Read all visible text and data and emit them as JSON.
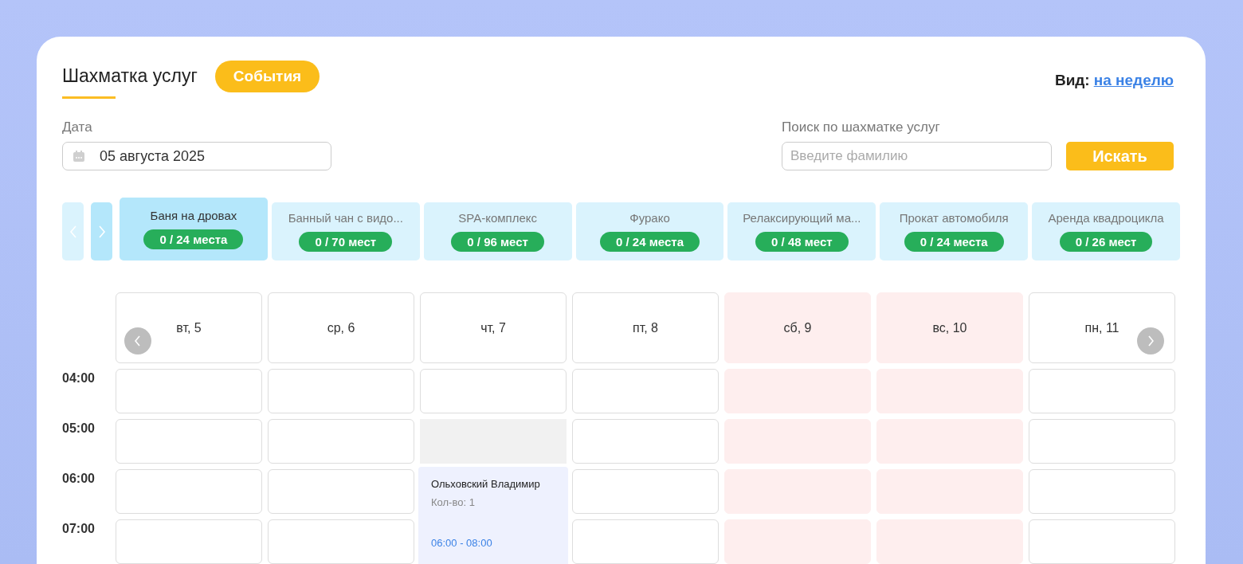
{
  "header": {
    "title": "Шахматка услуг",
    "events_button": "События",
    "view_label": "Вид:",
    "view_link": "на неделю"
  },
  "date": {
    "label": "Дата",
    "value": "05 августа 2025"
  },
  "search": {
    "label": "Поиск по шахматке услуг",
    "placeholder": "Введите фамилию",
    "button": "Искать"
  },
  "services_nav": {
    "prev_disabled": true,
    "next_disabled": false
  },
  "services": [
    {
      "name": "Баня на дровах",
      "places": "0 / 24 места",
      "selected": true
    },
    {
      "name": "Банный чан с видо...",
      "places": "0 / 70 мест",
      "selected": false
    },
    {
      "name": "SPA-комплекс",
      "places": "0 / 96 мест",
      "selected": false
    },
    {
      "name": "Фурако",
      "places": "0 / 24 места",
      "selected": false
    },
    {
      "name": "Релаксирующий ма...",
      "places": "0 / 48 мест",
      "selected": false
    },
    {
      "name": "Прокат автомобиля",
      "places": "0 / 24 места",
      "selected": false
    },
    {
      "name": "Аренда квадроцикла",
      "places": "0 / 26 мест",
      "selected": false
    }
  ],
  "days": [
    {
      "label": "вт, 5",
      "weekend": false
    },
    {
      "label": "ср, 6",
      "weekend": false
    },
    {
      "label": "чт, 7",
      "weekend": false
    },
    {
      "label": "пт, 8",
      "weekend": false
    },
    {
      "label": "сб, 9",
      "weekend": true
    },
    {
      "label": "вс, 10",
      "weekend": true
    },
    {
      "label": "пн, 11",
      "weekend": false
    }
  ],
  "rows": [
    {
      "time": "04:00",
      "cells": [
        {
          "kind": "free"
        },
        {
          "kind": "free"
        },
        {
          "kind": "free"
        },
        {
          "kind": "free"
        },
        {
          "kind": "free"
        },
        {
          "kind": "free"
        },
        {
          "kind": "free"
        }
      ]
    },
    {
      "time": "05:00",
      "cells": [
        {
          "kind": "free"
        },
        {
          "kind": "free"
        },
        {
          "kind": "blocked"
        },
        {
          "kind": "free"
        },
        {
          "kind": "free"
        },
        {
          "kind": "free"
        },
        {
          "kind": "free"
        }
      ]
    },
    {
      "time": "06:00",
      "cells": [
        {
          "kind": "free"
        },
        {
          "kind": "free"
        },
        {
          "kind": "booking",
          "name": "Ольховский Владимир",
          "quantity": "Кол-во: 1",
          "time": "06:00 - 08:00"
        },
        {
          "kind": "free"
        },
        {
          "kind": "free"
        },
        {
          "kind": "free"
        },
        {
          "kind": "free"
        }
      ]
    },
    {
      "time": "07:00",
      "cells": [
        {
          "kind": "free"
        },
        {
          "kind": "free"
        },
        {
          "kind": "continued"
        },
        {
          "kind": "free"
        },
        {
          "kind": "free"
        },
        {
          "kind": "free"
        },
        {
          "kind": "free"
        }
      ]
    }
  ]
}
